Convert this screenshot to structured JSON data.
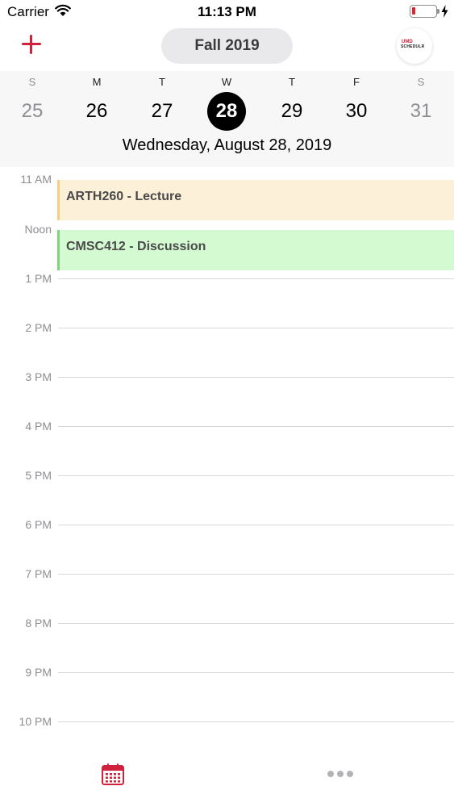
{
  "status_bar": {
    "carrier": "Carrier",
    "time": "11:13 PM",
    "battery_color": "#e0232e"
  },
  "nav": {
    "add_icon": "plus-icon",
    "term": "Fall 2019",
    "logo_top": "UMD",
    "logo_bottom": "SCHEDULR",
    "accent_color": "#d0213d"
  },
  "week": {
    "days": [
      {
        "letter": "S",
        "num": "25"
      },
      {
        "letter": "M",
        "num": "26"
      },
      {
        "letter": "T",
        "num": "27"
      },
      {
        "letter": "W",
        "num": "28"
      },
      {
        "letter": "T",
        "num": "29"
      },
      {
        "letter": "F",
        "num": "30"
      },
      {
        "letter": "S",
        "num": "31"
      }
    ],
    "selected_index": 3,
    "selected_date": "Wednesday, August 28, 2019"
  },
  "timeline": {
    "hours": [
      "11 AM",
      "Noon",
      "1 PM",
      "2 PM",
      "3 PM",
      "4 PM",
      "5 PM",
      "6 PM",
      "7 PM",
      "8 PM",
      "9 PM",
      "10 PM"
    ],
    "events": [
      {
        "title": "ARTH260 - Lecture",
        "color": "#fdf0d9"
      },
      {
        "title": "CMSC412 - Discussion",
        "color": "#d4fad1"
      }
    ]
  },
  "tab_bar": {
    "items": [
      {
        "icon": "calendar-icon",
        "color": "#d0213d"
      },
      {
        "icon": "more-icon",
        "color": "#b3b3b8"
      }
    ]
  }
}
